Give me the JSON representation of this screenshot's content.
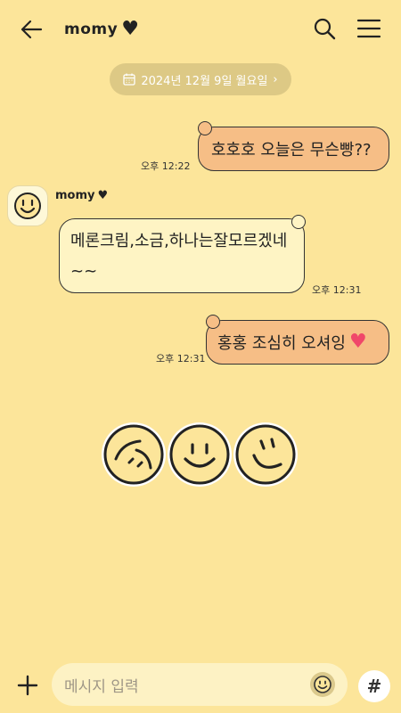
{
  "header": {
    "title": "momy",
    "title_heart": "♥"
  },
  "date_divider": {
    "label": "2024년 12월 9일 월요일",
    "chevron": "›"
  },
  "messages": [
    {
      "from": "me",
      "text": "호호호 오늘은 무슨빵??",
      "time": "오후 12:22"
    },
    {
      "from": "momy",
      "sender": "momy",
      "sender_heart": "♥",
      "text": "메론크림,소금,하나는잘모르겠네~~",
      "time": "오후 12:31"
    },
    {
      "from": "me",
      "text": "홍홍 조심히 오셔잉",
      "heart": "♥",
      "time": "오후 12:31"
    }
  ],
  "stickers": [
    "smiley-tilted-left-icon",
    "smiley-icon",
    "smiley-tilted-right-icon"
  ],
  "composer": {
    "placeholder": "메시지 입력",
    "plus": "+",
    "hash": "#"
  },
  "colors": {
    "background": "#FCE59A",
    "my_bubble": "#F6BE86",
    "their_bubble": "#FEF4C4",
    "date_pill": "#DDC985",
    "heart": "#F0476A"
  }
}
